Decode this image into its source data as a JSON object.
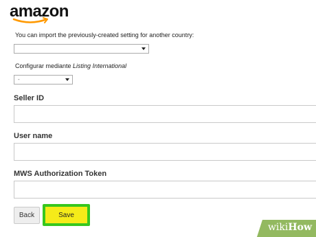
{
  "brand": {
    "name": "amazon"
  },
  "import_setting": {
    "label": "You can import the previously-created setting for another country:",
    "selected": ""
  },
  "configure": {
    "label_prefix": "Configurar mediante ",
    "label_italic": "Listing International",
    "selected": "-"
  },
  "fields": {
    "seller_id": {
      "label": "Seller ID",
      "value": ""
    },
    "user_name": {
      "label": "User name",
      "value": ""
    },
    "mws_token": {
      "label": "MWS Authorization Token",
      "value": ""
    }
  },
  "actions": {
    "back": "Back",
    "save": "Save"
  },
  "watermark": {
    "prefix": "wiki",
    "suffix": "How"
  },
  "colors": {
    "save_highlight": "#37c71e",
    "save_button": "#f5eb19"
  }
}
